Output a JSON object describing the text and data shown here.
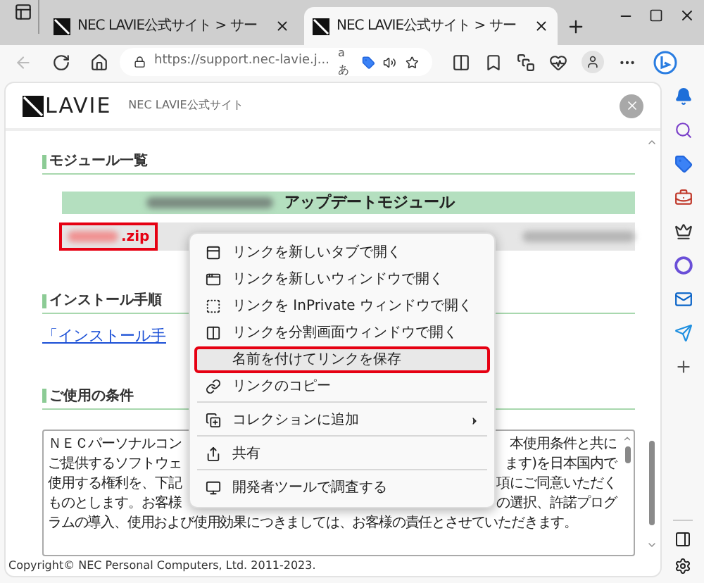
{
  "tabs": [
    {
      "title": "NEC LAVIE公式サイト > サー",
      "selected": false
    },
    {
      "title": "NEC LAVIE公式サイト > サー",
      "selected": true
    }
  ],
  "address_bar": {
    "url": "https://support.nec-lavie.j...",
    "reader_label": "aあ"
  },
  "site_header": {
    "brand": "LAVIE",
    "site_name": "NEC LAVIE公式サイト"
  },
  "module_section": {
    "heading": "モジュール一覧",
    "table_header": "アップデートモジュール",
    "file_suffix": ".zip",
    "annotated": true
  },
  "install_section": {
    "heading": "インストール手順",
    "link": "「インストール手"
  },
  "terms_section": {
    "heading": "ご使用の条件",
    "lines": [
      {
        "left": "ＮＥＣパーソナルコン",
        "right": "本使用条件と共に"
      },
      {
        "left": "ご提供するソフトウェ",
        "right": "ます)を日本国内で"
      },
      {
        "left": "使用する権利を、下記",
        "right": "項にご同意いただく"
      },
      {
        "left": "ものとします。お客様",
        "right": "の選択、許諾プログ"
      },
      {
        "left": "ラムの導入、使用および使用効果につきましては、お客様の責任とさせていただきます。"
      }
    ]
  },
  "context_menu": {
    "items": [
      {
        "label": "リンクを新しいタブで開く",
        "kind": "tab",
        "highlighted": false,
        "annotated": false,
        "submenu": false,
        "separator_after": false
      },
      {
        "label": "リンクを新しいウィンドウで開く",
        "kind": "window",
        "highlighted": false,
        "annotated": false,
        "submenu": false,
        "separator_after": false
      },
      {
        "label": "リンクを InPrivate ウィンドウで開く",
        "kind": "private",
        "highlighted": false,
        "annotated": false,
        "submenu": false,
        "separator_after": false
      },
      {
        "label": "リンクを分割画面ウィンドウで開く",
        "kind": "split",
        "highlighted": false,
        "annotated": false,
        "submenu": false,
        "separator_after": false
      },
      {
        "label": "名前を付けてリンクを保存",
        "kind": "save",
        "highlighted": true,
        "annotated": true,
        "submenu": false,
        "separator_after": false
      },
      {
        "label": "リンクのコピー",
        "kind": "link",
        "highlighted": false,
        "annotated": false,
        "submenu": false,
        "separator_after": true
      },
      {
        "label": "コレクションに追加",
        "kind": "collection",
        "highlighted": false,
        "annotated": false,
        "submenu": true,
        "separator_after": true
      },
      {
        "label": "共有",
        "kind": "share",
        "highlighted": false,
        "annotated": false,
        "submenu": false,
        "separator_after": true
      },
      {
        "label": "開発者ツールで調査する",
        "kind": "devtools",
        "highlighted": false,
        "annotated": false,
        "submenu": false,
        "separator_after": false
      }
    ]
  },
  "footer": "Copyright© NEC Personal Computers, Ltd. 2011-2023."
}
